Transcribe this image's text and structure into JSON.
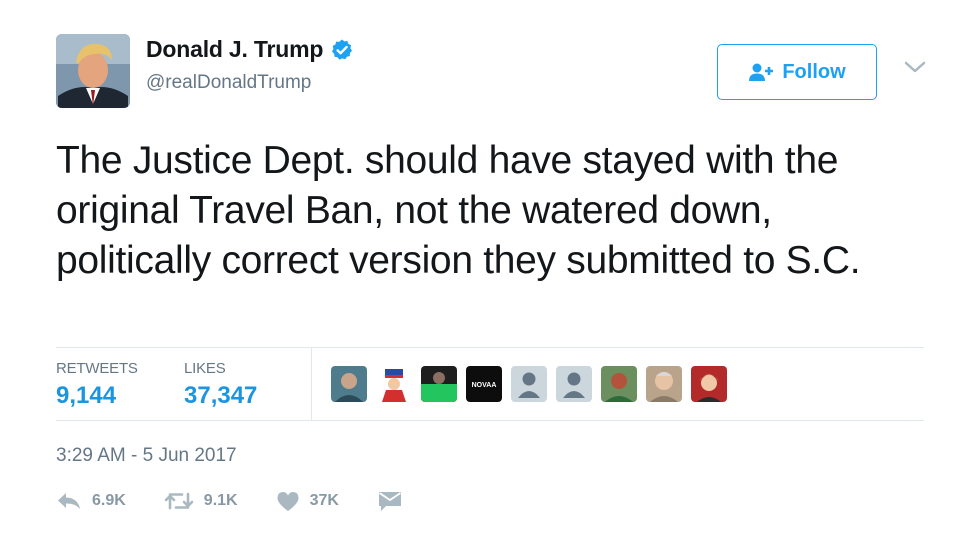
{
  "user": {
    "display_name": "Donald J. Trump",
    "handle": "@realDonaldTrump",
    "verified": true
  },
  "follow_button": {
    "label": "Follow",
    "icon": "add-user-icon"
  },
  "menu_icon": "chevron-down-icon",
  "tweet": {
    "text": "The Justice Dept. should have stayed with the original Travel Ban, not the watered down, politically correct version they submitted to S.C."
  },
  "stats": {
    "retweets_label": "RETWEETS",
    "retweets_value": "9,144",
    "likes_label": "LIKES",
    "likes_value": "37,347"
  },
  "likers": [
    {
      "name": "liker-1",
      "kind": "photo"
    },
    {
      "name": "liker-2",
      "kind": "cartoon"
    },
    {
      "name": "liker-3",
      "kind": "photo"
    },
    {
      "name": "liker-4",
      "kind": "logo",
      "text": "NOVAA"
    },
    {
      "name": "liker-5",
      "kind": "default"
    },
    {
      "name": "liker-6",
      "kind": "default"
    },
    {
      "name": "liker-7",
      "kind": "photo"
    },
    {
      "name": "liker-8",
      "kind": "photo"
    },
    {
      "name": "liker-9",
      "kind": "photo"
    }
  ],
  "timestamp": "3:29 AM - 5 Jun 2017",
  "actions": {
    "reply_count": "6.9K",
    "retweet_count": "9.1K",
    "like_count": "37K"
  },
  "colors": {
    "accent": "#1da1f2",
    "stat_value": "#1b95e0",
    "muted": "#657786",
    "border": "#e1e8ed"
  }
}
